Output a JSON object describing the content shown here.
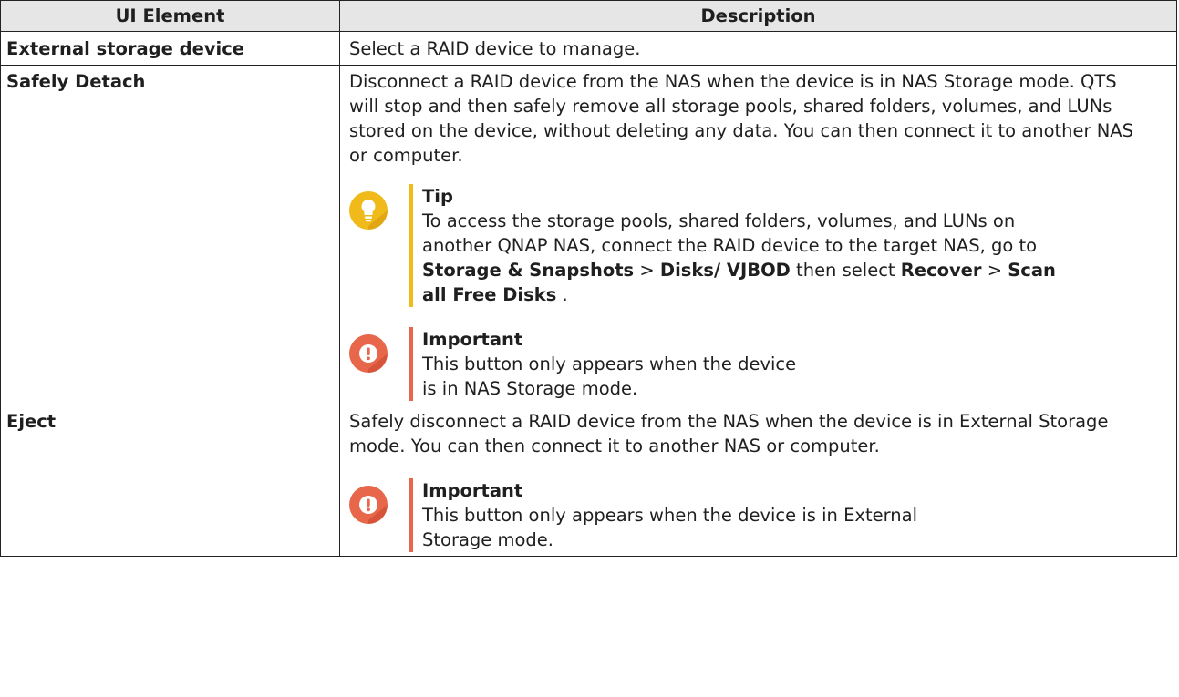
{
  "headers": {
    "element": "UI Element",
    "description": "Description"
  },
  "rows": [
    {
      "element": "External storage device",
      "description": "Select a RAID device to manage."
    },
    {
      "element": "Safely Detach",
      "description": "Disconnect a RAID device from the NAS when the device is in NAS Storage mode. QTS will stop and then safely remove all storage pools, shared folders, volumes, and LUNs stored on the device, without deleting any data. You can then connect it to another NAS or computer.",
      "tip": {
        "title": "Tip",
        "text_1": "To access the storage pools, shared folders, volumes, and LUNs on another QNAP NAS, connect the RAID device to the target NAS, go to ",
        "bold_1": "Storage & Snapshots",
        "sep_1": " > ",
        "bold_2": "Disks/ VJBOD",
        "text_2": " then select ",
        "bold_3": "Recover",
        "sep_2": " > ",
        "bold_4": "Scan all Free Disks",
        "text_3": " ."
      },
      "important": {
        "title": "Important",
        "text": "This button only appears when the device is in NAS Storage mode."
      }
    },
    {
      "element": "Eject",
      "description": "Safely disconnect a RAID device from the NAS when the device is in External Storage mode. You can then connect it to another NAS or computer.",
      "important": {
        "title": "Important",
        "text": "This button only appears when the device is in External Storage mode."
      }
    }
  ],
  "icons": {
    "tip": "lightbulb-icon",
    "important": "exclamation-icon"
  },
  "colors": {
    "tip": "#f0ba1b",
    "important": "#e8664a",
    "header_bg": "#e6e6e6"
  }
}
